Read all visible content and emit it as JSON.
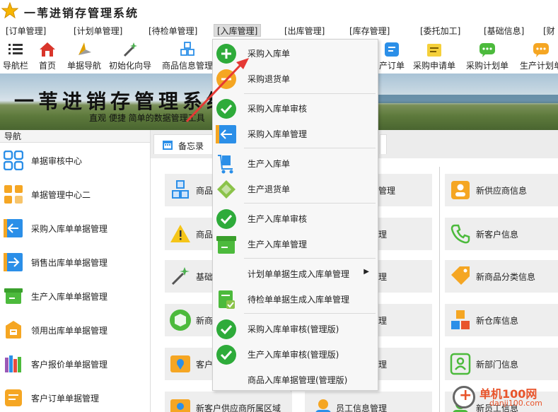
{
  "app": {
    "title": "一苇进销存管理系统"
  },
  "menu": [
    {
      "label": "[订单管理]"
    },
    {
      "label": "[计划单管理]"
    },
    {
      "label": "[待检单管理]"
    },
    {
      "label": "[入库管理]"
    },
    {
      "label": "[出库管理]"
    },
    {
      "label": "[库存管理]"
    },
    {
      "label": "[委托加工]"
    },
    {
      "label": "[基础信息]"
    },
    {
      "label": "[财"
    }
  ],
  "toolbar": [
    {
      "label": "导航栏",
      "icon": "list-icon"
    },
    {
      "label": "首页",
      "icon": "home-icon"
    },
    {
      "label": "单据导航",
      "icon": "compass-icon"
    },
    {
      "label": "初始化向导",
      "icon": "magic-wand-icon"
    },
    {
      "label": "商品信息管理",
      "icon": "cubes-icon"
    },
    {
      "label": "产订单",
      "icon": "order-icon"
    },
    {
      "label": "采购申请单",
      "icon": "note-icon"
    },
    {
      "label": "采购计划单",
      "icon": "chat-icon"
    },
    {
      "label": "生产计划单",
      "icon": "chat-icon"
    }
  ],
  "banner": {
    "title": "一苇进销存管理系统",
    "subtitle": "直观 便捷 简单的数据管理工具"
  },
  "nav": {
    "header": "导航",
    "items": [
      {
        "label": "单据审核中心",
        "icon": "grid-icon",
        "color": "#2b8fe8"
      },
      {
        "label": "单据管理中心二",
        "icon": "grid-icon",
        "color": "#f5a623"
      },
      {
        "label": "采购入库单单据管理",
        "icon": "arrow-in-icon",
        "color": "#2b8fe8"
      },
      {
        "label": "销售出库单单据管理",
        "icon": "arrow-out-icon",
        "color": "#2b8fe8"
      },
      {
        "label": "生产入库单单据管理",
        "icon": "box-icon",
        "color": "#4cba3c"
      },
      {
        "label": "领用出库单单据管理",
        "icon": "box-out-icon",
        "color": "#f5a623"
      },
      {
        "label": "客户报价单单据管理",
        "icon": "books-icon",
        "color": "#9b59b6"
      },
      {
        "label": "客户订单单据管理",
        "icon": "order-icon",
        "color": "#f5a623"
      }
    ]
  },
  "tabs": {
    "memo": "备忘录"
  },
  "cards_left": [
    {
      "label": "商品",
      "icon": "cubes-icon"
    },
    {
      "label": "商品",
      "icon": "warning-icon"
    },
    {
      "label": "基础",
      "icon": "magic-wand-icon"
    },
    {
      "label": "新商",
      "icon": "cube-icon"
    },
    {
      "label": "客户",
      "icon": "map-icon"
    },
    {
      "label": "新客户供应商所属区域",
      "icon": "map-icon"
    }
  ],
  "cards_mid": [
    {
      "label": "管理"
    },
    {
      "label": "理"
    },
    {
      "label": "理"
    },
    {
      "label": "理"
    },
    {
      "label": "理"
    },
    {
      "label": "员工信息管理"
    }
  ],
  "cards_right": [
    {
      "label": "新供应商信息",
      "icon": "supplier-icon"
    },
    {
      "label": "新客户信息",
      "icon": "phone-icon"
    },
    {
      "label": "新商品分类信息",
      "icon": "tag-icon"
    },
    {
      "label": "新仓库信息",
      "icon": "cubes-icon"
    },
    {
      "label": "新部门信息",
      "icon": "person-card-icon"
    },
    {
      "label": "新员工信息",
      "icon": "person-icon"
    }
  ],
  "dropdown": {
    "items": [
      {
        "label": "采购入库单",
        "icon": "plus-circle-icon",
        "has_submenu": false
      },
      {
        "label": "采购退货单",
        "icon": "minus-circle-icon",
        "has_submenu": false
      },
      {
        "label": "采购入库单审核",
        "icon": "check-circle-icon",
        "has_submenu": false
      },
      {
        "label": "采购入库单管理",
        "icon": "arrow-in-icon",
        "has_submenu": false
      },
      {
        "label": "生产入库单",
        "icon": "cart-icon",
        "has_submenu": false
      },
      {
        "label": "生产退货单",
        "icon": "diamond-icon",
        "has_submenu": false
      },
      {
        "label": "生产入库单审核",
        "icon": "check-circle-icon",
        "has_submenu": false
      },
      {
        "label": "生产入库单管理",
        "icon": "box-icon",
        "has_submenu": false
      },
      {
        "label": "计划单单据生成入库单管理",
        "icon": "",
        "has_submenu": true,
        "submenu_glyph": "▶"
      },
      {
        "label": "待检单单据生成入库单管理",
        "icon": "doc-check-icon",
        "has_submenu": false
      },
      {
        "label": "采购入库单审核(管理版)",
        "icon": "check-circle-icon",
        "has_submenu": false
      },
      {
        "label": "生产入库单审核(管理版)",
        "icon": "check-circle-icon",
        "has_submenu": false
      },
      {
        "label": "商品入库单据管理(管理版)",
        "icon": "",
        "has_submenu": false
      }
    ]
  },
  "watermark": {
    "line1": "单机100网",
    "line2": "danji100.com"
  },
  "colors": {
    "accent_green": "#2eab3a",
    "accent_orange": "#f5a623",
    "accent_blue": "#2b8fe8",
    "arrow_red": "#e53935"
  }
}
